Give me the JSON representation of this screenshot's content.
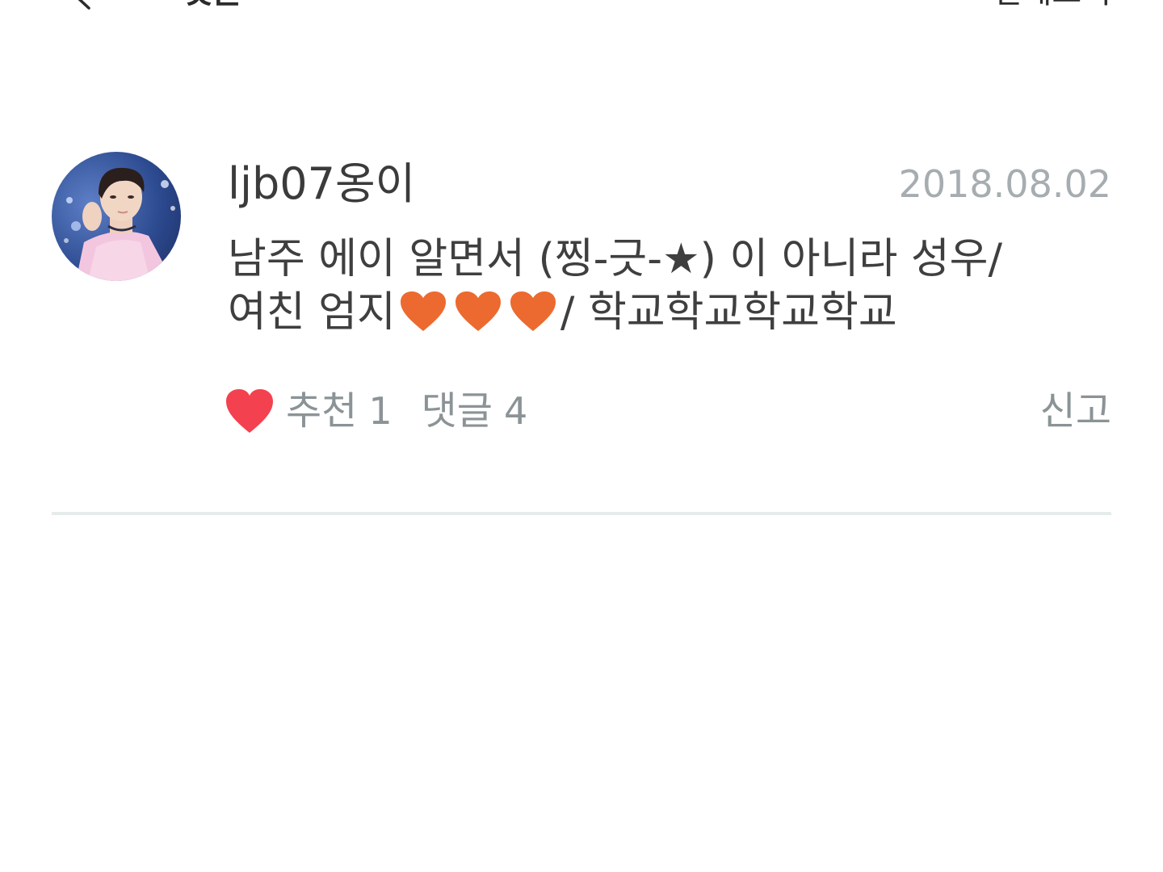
{
  "header": {
    "title": "댓글",
    "right_label": "전체보기"
  },
  "comment": {
    "username": "ljb07옹이",
    "date": "2018.08.02",
    "text_part1": "남주 에이 알면서 (찡-긋-★) 이 아니라 성우/ 여친 엄지",
    "text_part2": "/ 학교학교학교학교",
    "heart_count": 3,
    "like_label": "추천",
    "like_count": "1",
    "reply_label": "댓글",
    "reply_count": "4",
    "report_label": "신고"
  },
  "colors": {
    "like_heart": "#f4414f",
    "orange_heart": "#ec6a2f",
    "muted_text": "#8b9396",
    "date_text": "#a6adb0",
    "divider": "#e6ebeb"
  },
  "icons": {
    "back": "chevron-left-icon",
    "like": "heart-icon",
    "inline_emoji": "orange-heart-icon"
  }
}
